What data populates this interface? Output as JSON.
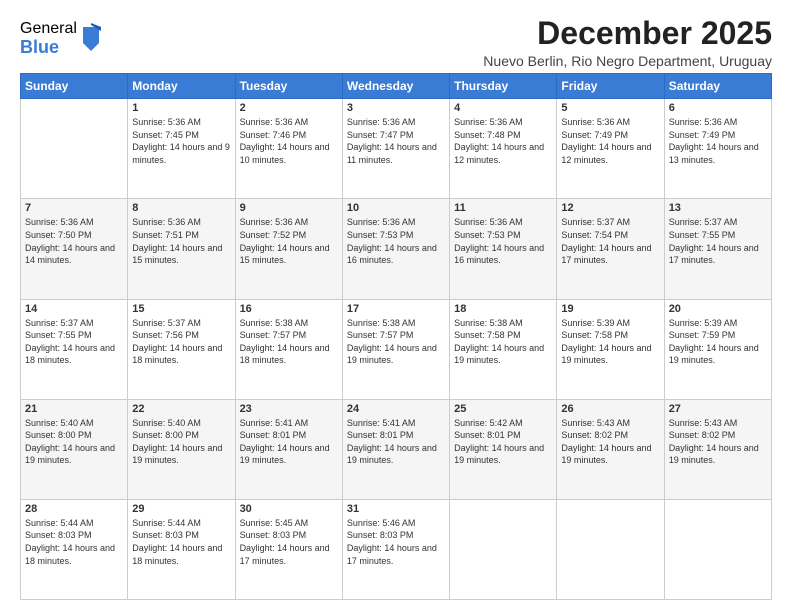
{
  "logo": {
    "general": "General",
    "blue": "Blue"
  },
  "header": {
    "month": "December 2025",
    "location": "Nuevo Berlin, Rio Negro Department, Uruguay"
  },
  "weekdays": [
    "Sunday",
    "Monday",
    "Tuesday",
    "Wednesday",
    "Thursday",
    "Friday",
    "Saturday"
  ],
  "weeks": [
    [
      {
        "day": "",
        "sunrise": "",
        "sunset": "",
        "daylight": ""
      },
      {
        "day": "1",
        "sunrise": "Sunrise: 5:36 AM",
        "sunset": "Sunset: 7:45 PM",
        "daylight": "Daylight: 14 hours and 9 minutes."
      },
      {
        "day": "2",
        "sunrise": "Sunrise: 5:36 AM",
        "sunset": "Sunset: 7:46 PM",
        "daylight": "Daylight: 14 hours and 10 minutes."
      },
      {
        "day": "3",
        "sunrise": "Sunrise: 5:36 AM",
        "sunset": "Sunset: 7:47 PM",
        "daylight": "Daylight: 14 hours and 11 minutes."
      },
      {
        "day": "4",
        "sunrise": "Sunrise: 5:36 AM",
        "sunset": "Sunset: 7:48 PM",
        "daylight": "Daylight: 14 hours and 12 minutes."
      },
      {
        "day": "5",
        "sunrise": "Sunrise: 5:36 AM",
        "sunset": "Sunset: 7:49 PM",
        "daylight": "Daylight: 14 hours and 12 minutes."
      },
      {
        "day": "6",
        "sunrise": "Sunrise: 5:36 AM",
        "sunset": "Sunset: 7:49 PM",
        "daylight": "Daylight: 14 hours and 13 minutes."
      }
    ],
    [
      {
        "day": "7",
        "sunrise": "Sunrise: 5:36 AM",
        "sunset": "Sunset: 7:50 PM",
        "daylight": "Daylight: 14 hours and 14 minutes."
      },
      {
        "day": "8",
        "sunrise": "Sunrise: 5:36 AM",
        "sunset": "Sunset: 7:51 PM",
        "daylight": "Daylight: 14 hours and 15 minutes."
      },
      {
        "day": "9",
        "sunrise": "Sunrise: 5:36 AM",
        "sunset": "Sunset: 7:52 PM",
        "daylight": "Daylight: 14 hours and 15 minutes."
      },
      {
        "day": "10",
        "sunrise": "Sunrise: 5:36 AM",
        "sunset": "Sunset: 7:53 PM",
        "daylight": "Daylight: 14 hours and 16 minutes."
      },
      {
        "day": "11",
        "sunrise": "Sunrise: 5:36 AM",
        "sunset": "Sunset: 7:53 PM",
        "daylight": "Daylight: 14 hours and 16 minutes."
      },
      {
        "day": "12",
        "sunrise": "Sunrise: 5:37 AM",
        "sunset": "Sunset: 7:54 PM",
        "daylight": "Daylight: 14 hours and 17 minutes."
      },
      {
        "day": "13",
        "sunrise": "Sunrise: 5:37 AM",
        "sunset": "Sunset: 7:55 PM",
        "daylight": "Daylight: 14 hours and 17 minutes."
      }
    ],
    [
      {
        "day": "14",
        "sunrise": "Sunrise: 5:37 AM",
        "sunset": "Sunset: 7:55 PM",
        "daylight": "Daylight: 14 hours and 18 minutes."
      },
      {
        "day": "15",
        "sunrise": "Sunrise: 5:37 AM",
        "sunset": "Sunset: 7:56 PM",
        "daylight": "Daylight: 14 hours and 18 minutes."
      },
      {
        "day": "16",
        "sunrise": "Sunrise: 5:38 AM",
        "sunset": "Sunset: 7:57 PM",
        "daylight": "Daylight: 14 hours and 18 minutes."
      },
      {
        "day": "17",
        "sunrise": "Sunrise: 5:38 AM",
        "sunset": "Sunset: 7:57 PM",
        "daylight": "Daylight: 14 hours and 19 minutes."
      },
      {
        "day": "18",
        "sunrise": "Sunrise: 5:38 AM",
        "sunset": "Sunset: 7:58 PM",
        "daylight": "Daylight: 14 hours and 19 minutes."
      },
      {
        "day": "19",
        "sunrise": "Sunrise: 5:39 AM",
        "sunset": "Sunset: 7:58 PM",
        "daylight": "Daylight: 14 hours and 19 minutes."
      },
      {
        "day": "20",
        "sunrise": "Sunrise: 5:39 AM",
        "sunset": "Sunset: 7:59 PM",
        "daylight": "Daylight: 14 hours and 19 minutes."
      }
    ],
    [
      {
        "day": "21",
        "sunrise": "Sunrise: 5:40 AM",
        "sunset": "Sunset: 8:00 PM",
        "daylight": "Daylight: 14 hours and 19 minutes."
      },
      {
        "day": "22",
        "sunrise": "Sunrise: 5:40 AM",
        "sunset": "Sunset: 8:00 PM",
        "daylight": "Daylight: 14 hours and 19 minutes."
      },
      {
        "day": "23",
        "sunrise": "Sunrise: 5:41 AM",
        "sunset": "Sunset: 8:01 PM",
        "daylight": "Daylight: 14 hours and 19 minutes."
      },
      {
        "day": "24",
        "sunrise": "Sunrise: 5:41 AM",
        "sunset": "Sunset: 8:01 PM",
        "daylight": "Daylight: 14 hours and 19 minutes."
      },
      {
        "day": "25",
        "sunrise": "Sunrise: 5:42 AM",
        "sunset": "Sunset: 8:01 PM",
        "daylight": "Daylight: 14 hours and 19 minutes."
      },
      {
        "day": "26",
        "sunrise": "Sunrise: 5:43 AM",
        "sunset": "Sunset: 8:02 PM",
        "daylight": "Daylight: 14 hours and 19 minutes."
      },
      {
        "day": "27",
        "sunrise": "Sunrise: 5:43 AM",
        "sunset": "Sunset: 8:02 PM",
        "daylight": "Daylight: 14 hours and 19 minutes."
      }
    ],
    [
      {
        "day": "28",
        "sunrise": "Sunrise: 5:44 AM",
        "sunset": "Sunset: 8:03 PM",
        "daylight": "Daylight: 14 hours and 18 minutes."
      },
      {
        "day": "29",
        "sunrise": "Sunrise: 5:44 AM",
        "sunset": "Sunset: 8:03 PM",
        "daylight": "Daylight: 14 hours and 18 minutes."
      },
      {
        "day": "30",
        "sunrise": "Sunrise: 5:45 AM",
        "sunset": "Sunset: 8:03 PM",
        "daylight": "Daylight: 14 hours and 17 minutes."
      },
      {
        "day": "31",
        "sunrise": "Sunrise: 5:46 AM",
        "sunset": "Sunset: 8:03 PM",
        "daylight": "Daylight: 14 hours and 17 minutes."
      },
      {
        "day": "",
        "sunrise": "",
        "sunset": "",
        "daylight": ""
      },
      {
        "day": "",
        "sunrise": "",
        "sunset": "",
        "daylight": ""
      },
      {
        "day": "",
        "sunrise": "",
        "sunset": "",
        "daylight": ""
      }
    ]
  ]
}
